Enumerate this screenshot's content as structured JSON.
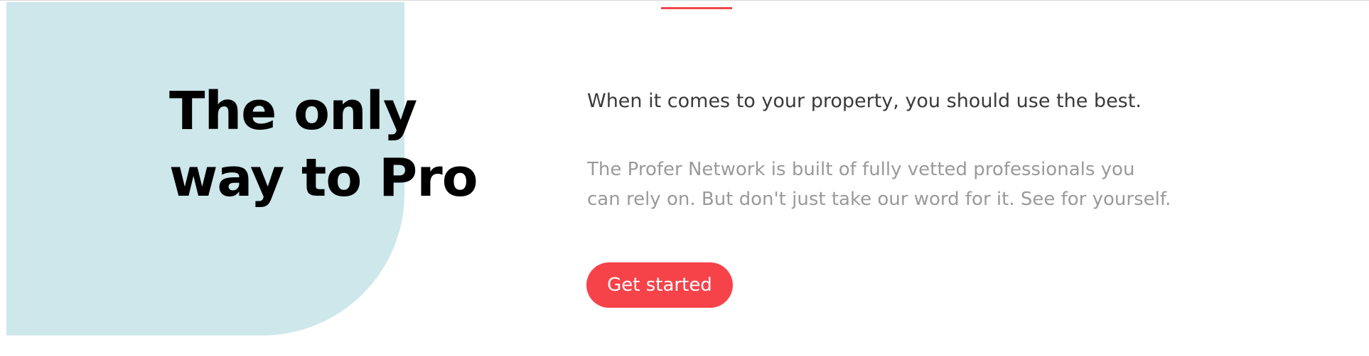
{
  "hero": {
    "headline_line1": "The only",
    "headline_line2": "way to Pro",
    "lead": "When it comes to your property, you should use the best.",
    "description_line1": "The Profer Network is built of fully vetted professionals you",
    "description_line2": "can rely on. But don't just take our word for it. See for yourself.",
    "cta_label": "Get started"
  },
  "colors": {
    "accent": "#f6434a",
    "shape": "#cde7eb",
    "heading": "#000000",
    "lead_text": "#3a3a3a",
    "body_text": "#9a9a9a"
  }
}
